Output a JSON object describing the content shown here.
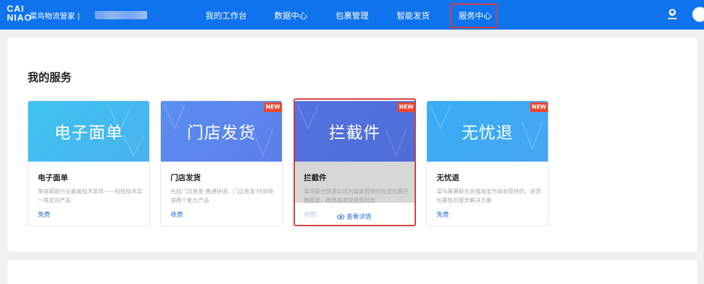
{
  "header": {
    "logo_mark": "CAI NIAO",
    "logo_text": "菜鸟物流管家 |",
    "nav": [
      {
        "label": "我的工作台"
      },
      {
        "label": "数据中心"
      },
      {
        "label": "包裹管理"
      },
      {
        "label": "智能发货"
      },
      {
        "label": "服务中心",
        "active": true
      }
    ],
    "icons": [
      "location-icon",
      "avatar"
    ]
  },
  "main": {
    "title": "我的服务",
    "cards": [
      {
        "banner": "电子面单",
        "title": "电子面单",
        "desc": "荣获邮政行业最高技术奖项——科技技术奖一等奖的产品",
        "price": "免费",
        "new": false,
        "color": "#40b9ef"
      },
      {
        "banner": "门店发货",
        "title": "门店发货",
        "desc": "包括门店直发-普通快递、门店直发-时效快递两个能力产品",
        "price": "收费",
        "new": true,
        "new_label": "NEW",
        "color": "#5d83ea"
      },
      {
        "banner": "拦截件",
        "title": "拦截件",
        "desc": "菜鸟联合快递公司为商家提供的在途包裹拦截服务，降低商家仅退款时长",
        "price": "收费",
        "new": true,
        "new_label": "NEW",
        "color": "#5b7fe3",
        "view_details": "查看详情",
        "hovered": true
      },
      {
        "banner": "无忧退",
        "title": "无忧退",
        "desc": "菜鸟裹裹联合天猫淘宝为商家提供的、退货包裹售后服务解决方案",
        "price": "免费",
        "new": true,
        "new_label": "NEW",
        "color": "#3ea6f3"
      }
    ]
  },
  "colors": {
    "topbar": "#0f73ee",
    "highlight": "#d63a3a",
    "link": "#2a6fdb"
  }
}
